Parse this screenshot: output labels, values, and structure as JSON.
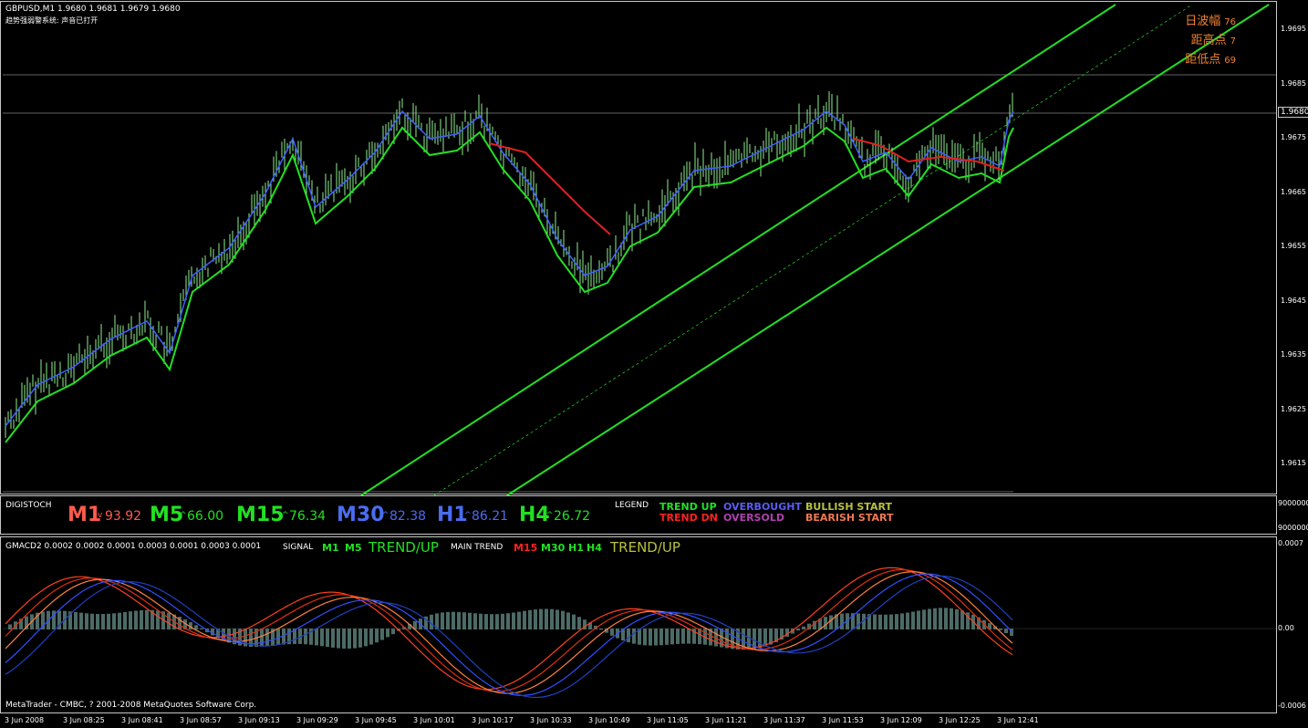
{
  "main": {
    "title": "GBPUSD,M1  1.9680 1.9681 1.9679 1.9680",
    "subtitle": "趋势强弱警系统: 声音已打开",
    "info": [
      {
        "label": "日波幅",
        "value": "76"
      },
      {
        "label": "距高点",
        "value": "7"
      },
      {
        "label": "距低点",
        "value": "69"
      }
    ],
    "price_labels": [
      "1.9695",
      "1.9685",
      "1.9675",
      "1.9665",
      "1.9655",
      "1.9645",
      "1.9635",
      "1.9625",
      "1.9615"
    ],
    "current_price": "1.9680"
  },
  "stoch": {
    "name": "DIGISTOCH",
    "timeframes": [
      {
        "tf": "M1",
        "arrow": "v",
        "value": "93.92",
        "color": "#ff5a4a"
      },
      {
        "tf": "M5",
        "arrow": "^",
        "value": "66.00",
        "color": "#22e022"
      },
      {
        "tf": "M15",
        "arrow": "^",
        "value": "76.34",
        "color": "#22e022"
      },
      {
        "tf": "M30",
        "arrow": "^",
        "value": "82.38",
        "color": "#4a6cf0"
      },
      {
        "tf": "H1",
        "arrow": "^",
        "value": "86.21",
        "color": "#4a6cf0"
      },
      {
        "tf": "H4",
        "arrow": "^",
        "value": "26.72",
        "color": "#22e022"
      }
    ],
    "legend_title": "LEGEND",
    "legend": [
      {
        "text": "TREND UP",
        "color": "#22e022"
      },
      {
        "text": "TREND DN",
        "color": "#ff2020"
      },
      {
        "text": "OVERBOUGHT",
        "color": "#5a5cf0"
      },
      {
        "text": "OVERSOLD",
        "color": "#b040b0"
      },
      {
        "text": "BULLISH START",
        "color": "#b8c040"
      },
      {
        "text": "BEARISH START",
        "color": "#f07850"
      }
    ],
    "axis": [
      "9000000",
      "9000000"
    ]
  },
  "macd": {
    "title": "GMACD2 0.0002 0.0002 0.0001 0.0003 0.0001 0.0003 0.0001",
    "signal_label": "SIGNAL",
    "signal_tfs": [
      "M1",
      "M5"
    ],
    "signal_trend": "TREND/UP",
    "main_label": "MAIN TREND",
    "main_tfs": [
      {
        "tf": "M15",
        "color": "#ff2020"
      },
      {
        "tf": "M30",
        "color": "#22e022"
      },
      {
        "tf": "H1",
        "color": "#22e022"
      },
      {
        "tf": "H4",
        "color": "#22e022"
      }
    ],
    "main_trend": "TREND/UP",
    "axis": [
      "0.0007",
      "0.00",
      "-0.0006"
    ],
    "copyright": "MetaTrader - CMBC, ? 2001-2008 MetaQuotes Software Corp."
  },
  "time_labels": [
    "3 Jun 2008",
    "3 Jun 08:25",
    "3 Jun 08:41",
    "3 Jun 08:57",
    "3 Jun 09:13",
    "3 Jun 09:29",
    "3 Jun 09:45",
    "3 Jun 10:01",
    "3 Jun 10:17",
    "3 Jun 10:33",
    "3 Jun 10:49",
    "3 Jun 11:05",
    "3 Jun 11:21",
    "3 Jun 11:37",
    "3 Jun 11:53",
    "3 Jun 12:09",
    "3 Jun 12:25",
    "3 Jun 12:41"
  ],
  "colors": {
    "candle": "#90ee90",
    "ma_fast": "#4060ff",
    "ma_slow": "#22e022",
    "ma_down": "#e02020",
    "channel": "#22e022"
  }
}
